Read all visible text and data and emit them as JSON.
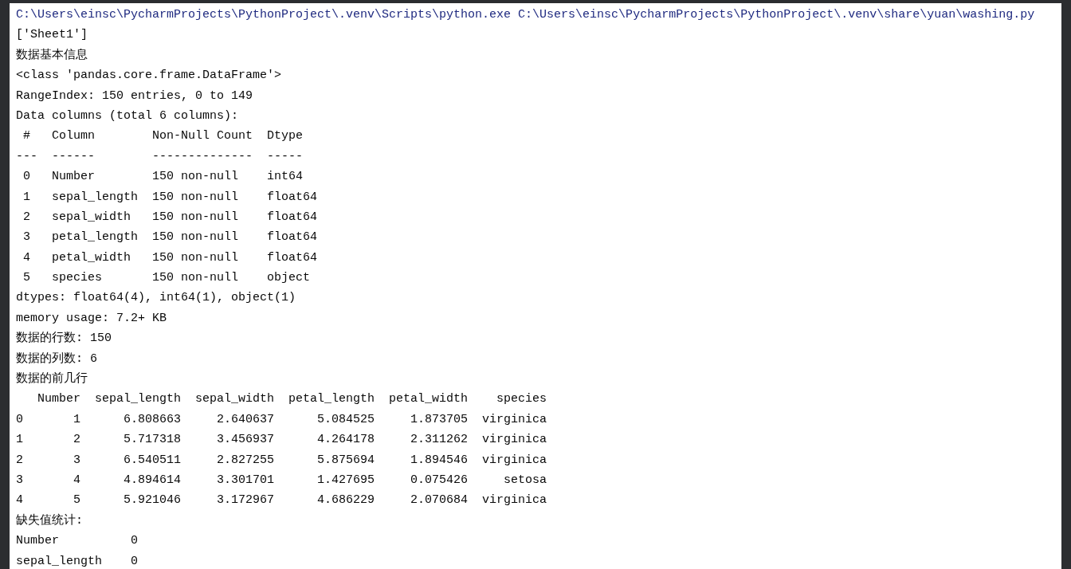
{
  "console": {
    "lines": [
      {
        "kind": "command",
        "text": "C:\\Users\\einsc\\PycharmProjects\\PythonProject\\.venv\\Scripts\\python.exe C:\\Users\\einsc\\PycharmProjects\\PythonProject\\.venv\\share\\yuan\\washing.py"
      },
      {
        "kind": "output",
        "text": "['Sheet1']"
      },
      {
        "kind": "output",
        "text": "数据基本信息"
      },
      {
        "kind": "output",
        "text": "<class 'pandas.core.frame.DataFrame'>"
      },
      {
        "kind": "output",
        "text": "RangeIndex: 150 entries, 0 to 149"
      },
      {
        "kind": "output",
        "text": "Data columns (total 6 columns):"
      },
      {
        "kind": "output",
        "text": " #   Column        Non-Null Count  Dtype"
      },
      {
        "kind": "output",
        "text": "---  ------        --------------  -----"
      },
      {
        "kind": "output",
        "text": " 0   Number        150 non-null    int64"
      },
      {
        "kind": "output",
        "text": " 1   sepal_length  150 non-null    float64"
      },
      {
        "kind": "output",
        "text": " 2   sepal_width   150 non-null    float64"
      },
      {
        "kind": "output",
        "text": " 3   petal_length  150 non-null    float64"
      },
      {
        "kind": "output",
        "text": " 4   petal_width   150 non-null    float64"
      },
      {
        "kind": "output",
        "text": " 5   species       150 non-null    object"
      },
      {
        "kind": "output",
        "text": "dtypes: float64(4), int64(1), object(1)"
      },
      {
        "kind": "output",
        "text": "memory usage: 7.2+ KB"
      },
      {
        "kind": "output",
        "text": "数据的行数: 150"
      },
      {
        "kind": "output",
        "text": "数据的列数: 6"
      },
      {
        "kind": "output",
        "text": "数据的前几行"
      },
      {
        "kind": "output",
        "text": "   Number  sepal_length  sepal_width  petal_length  petal_width    species"
      },
      {
        "kind": "output",
        "text": "0       1      6.808663     2.640637      5.084525     1.873705  virginica"
      },
      {
        "kind": "output",
        "text": "1       2      5.717318     3.456937      4.264178     2.311262  virginica"
      },
      {
        "kind": "output",
        "text": "2       3      6.540511     2.827255      5.875694     1.894546  virginica"
      },
      {
        "kind": "output",
        "text": "3       4      4.894614     3.301701      1.427695     0.075426     setosa"
      },
      {
        "kind": "output",
        "text": "4       5      5.921046     3.172967      4.686229     2.070684  virginica"
      },
      {
        "kind": "output",
        "text": "缺失值统计:"
      },
      {
        "kind": "output",
        "text": "Number          0"
      },
      {
        "kind": "output",
        "text": "sepal_length    0"
      }
    ]
  }
}
